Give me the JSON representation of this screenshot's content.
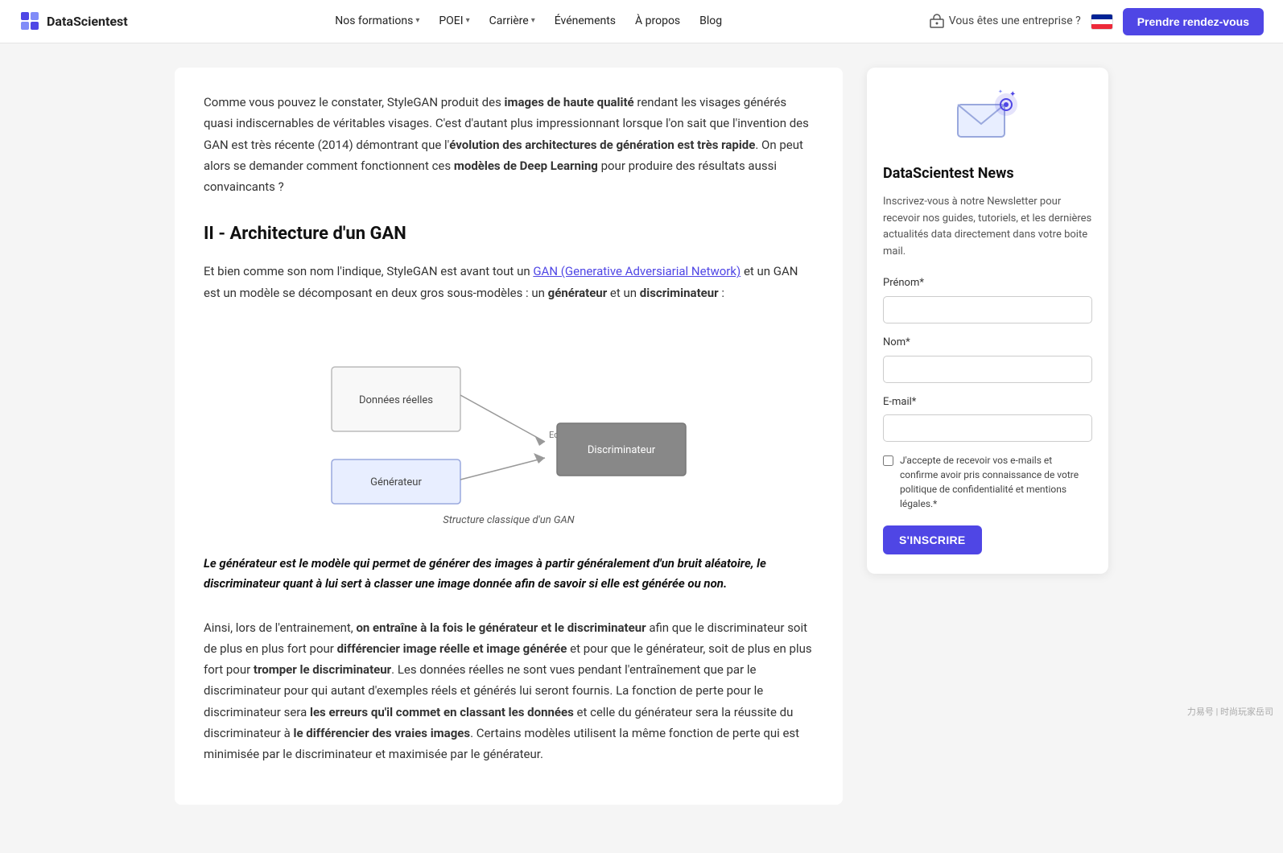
{
  "nav": {
    "logo_text": "DataScientest",
    "items": [
      {
        "label": "Nos formations",
        "has_dropdown": true
      },
      {
        "label": "POEI",
        "has_dropdown": true
      },
      {
        "label": "Carrière",
        "has_dropdown": true
      },
      {
        "label": "Événements",
        "has_dropdown": false
      },
      {
        "label": "À propos",
        "has_dropdown": false
      },
      {
        "label": "Blog",
        "has_dropdown": false
      }
    ],
    "enterprise_label": "Vous êtes une entreprise ?",
    "cta_label": "Prendre rendez-vous"
  },
  "main": {
    "intro_paragraph": "Comme vous pouvez le constater, StyleGAN produit des images de haute qualité rendant les visages générés quasi indiscernables de véritables visages. C'est d'autant plus impressionnant lorsque l'on sait que l'invention des GAN est très récente (2014) démontrant que l'évolution des architectures de génération est très rapide. On peut alors se demander comment fonctionnent ces modèles de Deep Learning pour produire des résultats aussi convaincants ?",
    "section_title": "II - Architecture d'un GAN",
    "section_text": "Et bien comme son nom l'indique, StyleGAN est avant tout un GAN (Generative Adversiarial Network) et un GAN est un modèle se décomposant en deux gros sous-modèles : un générateur et un discriminateur :",
    "diagram_caption": "Structure classique d'un GAN",
    "blockquote": "Le générateur est le modèle qui permet de générer des images à partir généralement d'un bruit aléatoire, le discriminateur quant à lui sert à classer une image donnée afin de savoir si elle est générée ou non.",
    "final_paragraph": "Ainsi, lors de l'entrainement, on entraîne à la fois le générateur et le discriminateur afin que le discriminateur soit de plus en plus fort pour différencier image réelle et image générée et pour que le générateur, soit de plus en plus fort pour tromper le discriminateur. Les données réelles ne sont vues pendant l'entraînement que par le discriminateur pour qui autant d'exemples réels et générés lui seront fournis. La fonction de perte pour le discriminateur sera les erreurs qu'il commet en classant les données et celle du générateur sera la réussite du discriminateur à le différencier des vraies images. Certains modèles utilisent la même fonction de perte qui est minimisée par le discriminateur et maximisée par le générateur.",
    "link_text": "GAN (Generative Adversiarial Network)"
  },
  "sidebar": {
    "newsletter_title": "DataScientest News",
    "newsletter_desc": "Inscrivez-vous à notre Newsletter pour recevoir nos guides, tutoriels, et les dernières actualités data directement dans votre boite mail.",
    "prenom_label": "Prénom*",
    "nom_label": "Nom*",
    "email_label": "E-mail*",
    "checkbox_text": "J'accepte de recevoir vos e-mails et confirme avoir pris connaissance de votre politique de confidentialité et mentions légales.*",
    "subscribe_button": "S'INSCRIRE"
  },
  "watermark": "力易号 | 时尚玩家岳司"
}
